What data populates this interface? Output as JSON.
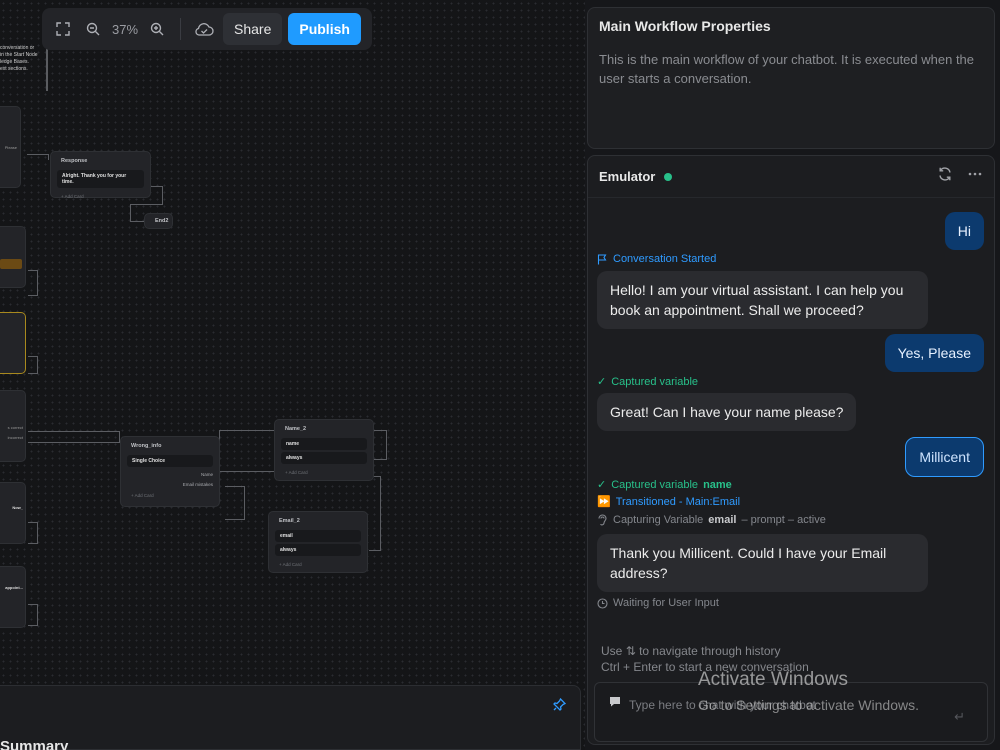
{
  "toolbar": {
    "zoom": "37%",
    "share_label": "Share",
    "publish_label": "Publish"
  },
  "canvas": {
    "note_lines": [
      "conversation or",
      "",
      "in the Start Node",
      "ledge Bases.",
      "",
      "ext sections."
    ],
    "response_node": {
      "title": "Response",
      "message": "Alright. Thank you for your time.",
      "add_card": "+ Add Card"
    },
    "end_node": {
      "title": "End2"
    },
    "wrong_info_node": {
      "title": "Wrong_info",
      "card": "Single Choice",
      "option1": "Name",
      "option2": "Email mistakes",
      "add_card": "+ Add Card"
    },
    "name2_node": {
      "title": "Name_2",
      "row1": "name",
      "row2": "always",
      "add_card": "+ Add Card"
    },
    "email2_node": {
      "title": "Email_2",
      "row1": "email",
      "row2": "always",
      "add_card": "+ Add Card"
    },
    "stub_labels": [
      "Please",
      "Know",
      "s correct",
      "incorrect",
      "Now_",
      "appoint..."
    ]
  },
  "bottom_panel": {
    "title": "Summary"
  },
  "properties": {
    "title": "Main Workflow Properties",
    "description": "This is the main workflow of your chatbot. It is executed when the user starts a conversation."
  },
  "emulator": {
    "title": "Emulator",
    "status_color": "#28c08a",
    "messages": {
      "user_hi": "Hi",
      "event_started": "Conversation Started",
      "bot_hello": "Hello! I am your virtual assistant. I can help you book an appointment. Shall we proceed?",
      "user_yes": "Yes, Please",
      "event_captured1": "Captured variable",
      "bot_name": "Great! Can I have your name please?",
      "user_millicent": "Millicent",
      "event_captured2_prefix": "Captured variable",
      "event_captured2_var": "name",
      "event_transition": "Transitioned - Main:Email",
      "event_capturing_prefix": "Capturing Variable",
      "event_capturing_var": "email",
      "event_capturing_suffix": "– prompt – active",
      "bot_email": "Thank you Millicent. Could I have your Email address?",
      "event_waiting": "Waiting for User Input"
    },
    "hint1_prefix": "Use",
    "hint1_suffix": "to navigate through history",
    "hint2": "Ctrl + Enter to start a new conversation",
    "input_placeholder": "Type here to chat with your chatbot"
  },
  "watermark": {
    "line1": "Activate Windows",
    "line2": "Go to Settings to activate Windows."
  }
}
